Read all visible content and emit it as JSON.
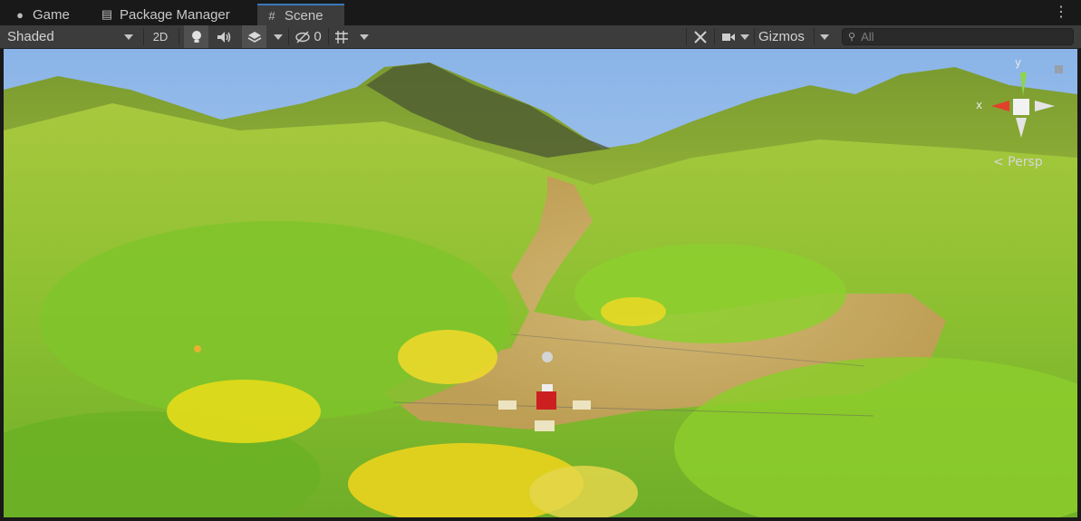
{
  "tabs": [
    {
      "icon": "gamepad-icon",
      "glyph": "🎮",
      "label": "Game"
    },
    {
      "icon": "package-icon",
      "glyph": "▤",
      "label": "Package Manager"
    },
    {
      "icon": "grid-icon",
      "glyph": "#",
      "label": "Scene"
    }
  ],
  "toolbar": {
    "draw_mode": "Shaded",
    "toggle_2d": "2D",
    "hidden_count": "0",
    "gizmos": "Gizmos",
    "search_placeholder": "All"
  },
  "scene_gizmo": {
    "axis_y": "y",
    "axis_x": "x",
    "projection": "< Persp"
  },
  "colors": {
    "accent": "#3a79bb",
    "toolbar_bg": "#3c3c3c",
    "tab_bg": "#191919"
  }
}
